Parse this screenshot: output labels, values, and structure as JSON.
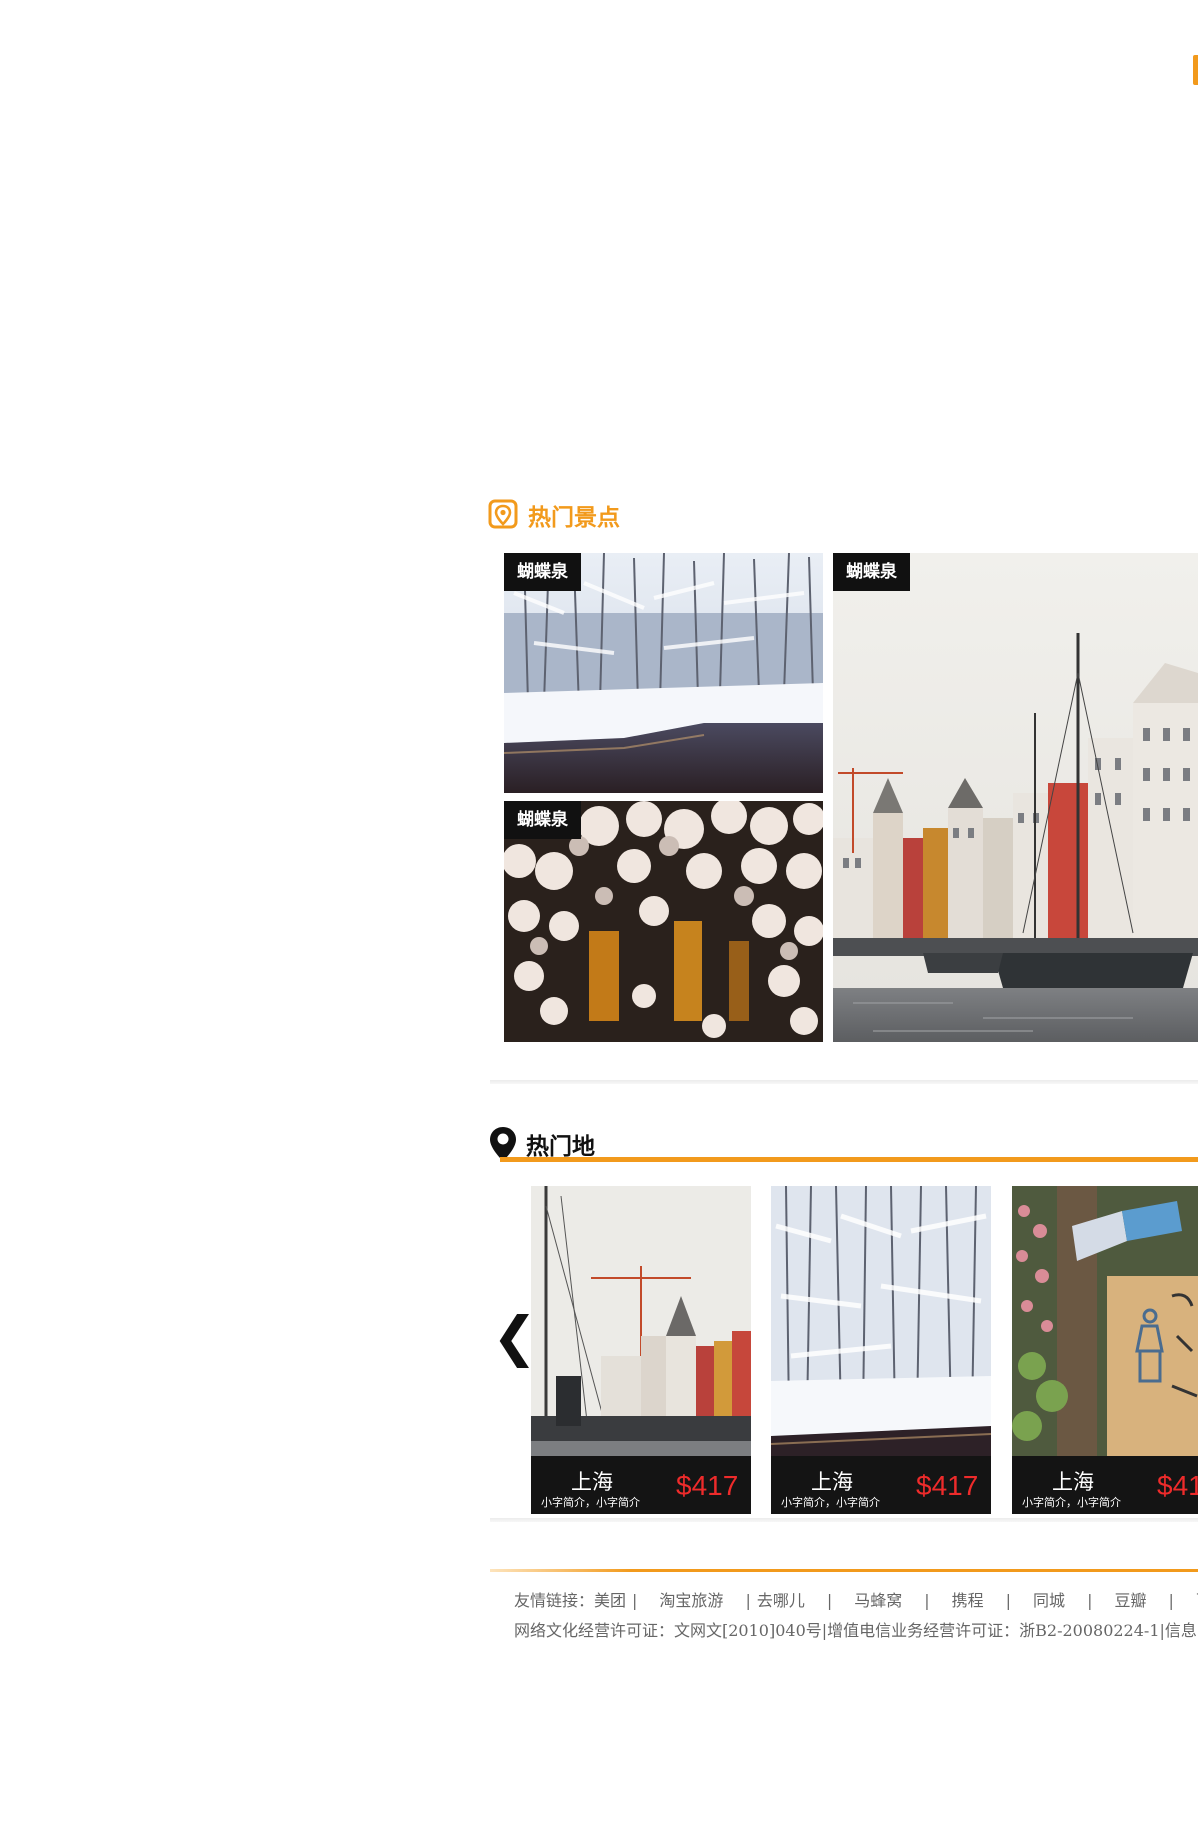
{
  "colors": {
    "accent": "#f29a1c",
    "price": "#ee2b2b",
    "label_bg": "#111111"
  },
  "spots": {
    "title": "热门景点",
    "icon": "map-pin-square-icon",
    "items": [
      {
        "label": "蝴蝶泉",
        "scene": "snowy river forest"
      },
      {
        "label": "蝴蝶泉",
        "scene": "night cherry blossoms"
      },
      {
        "label": "蝴蝶泉",
        "scene": "harbour canal with boats"
      }
    ]
  },
  "destinations": {
    "title": "热门地",
    "icon": "location-pin-icon",
    "prev_arrow": "❮",
    "cards": [
      {
        "city": "上海",
        "desc": "小字简介，小字简介",
        "price": "$417"
      },
      {
        "city": "上海",
        "desc": "小字简介，小字简介",
        "price": "$417"
      },
      {
        "city": "上海",
        "desc": "小字简介，小字简介",
        "price": "$41"
      }
    ]
  },
  "footer": {
    "links_prefix": "友情链接：",
    "links": [
      "美团",
      "淘宝旅游",
      "去哪儿",
      "马蜂窝",
      "携程",
      "同城",
      "豆瓣",
      "百度"
    ],
    "license": "网络文化经营许可证：文网文[2010]040号|增值电信业务经营许可证：浙B2-20080224-1|信息"
  }
}
